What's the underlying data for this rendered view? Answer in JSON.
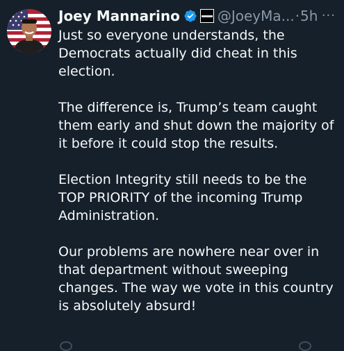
{
  "tweet": {
    "author": {
      "display_name": "Joey Mannarino",
      "handle": "@JoeyMa...",
      "avatar_icon": "profile-photo-icon",
      "verified_color": "#1d9bf0"
    },
    "separator": "·",
    "timestamp": "5h",
    "more_label": "···",
    "paragraphs": [
      {
        "lines": [
          "Just so everyone understands, the",
          "Democrats actually did cheat in this",
          "election."
        ]
      },
      {
        "lines": [
          "The difference is, Trump’s team caught",
          "them early and shut down the majority of",
          "it before it could stop the results."
        ]
      },
      {
        "lines": [
          "Election Integrity still needs to be the",
          "TOP PRIORITY of the incoming Trump",
          "Administration."
        ]
      },
      {
        "lines": [
          "Our problems are nowhere near over in",
          "that department without sweeping",
          "changes. The way we vote in this country",
          "is absolutely absurd!"
        ]
      }
    ]
  }
}
